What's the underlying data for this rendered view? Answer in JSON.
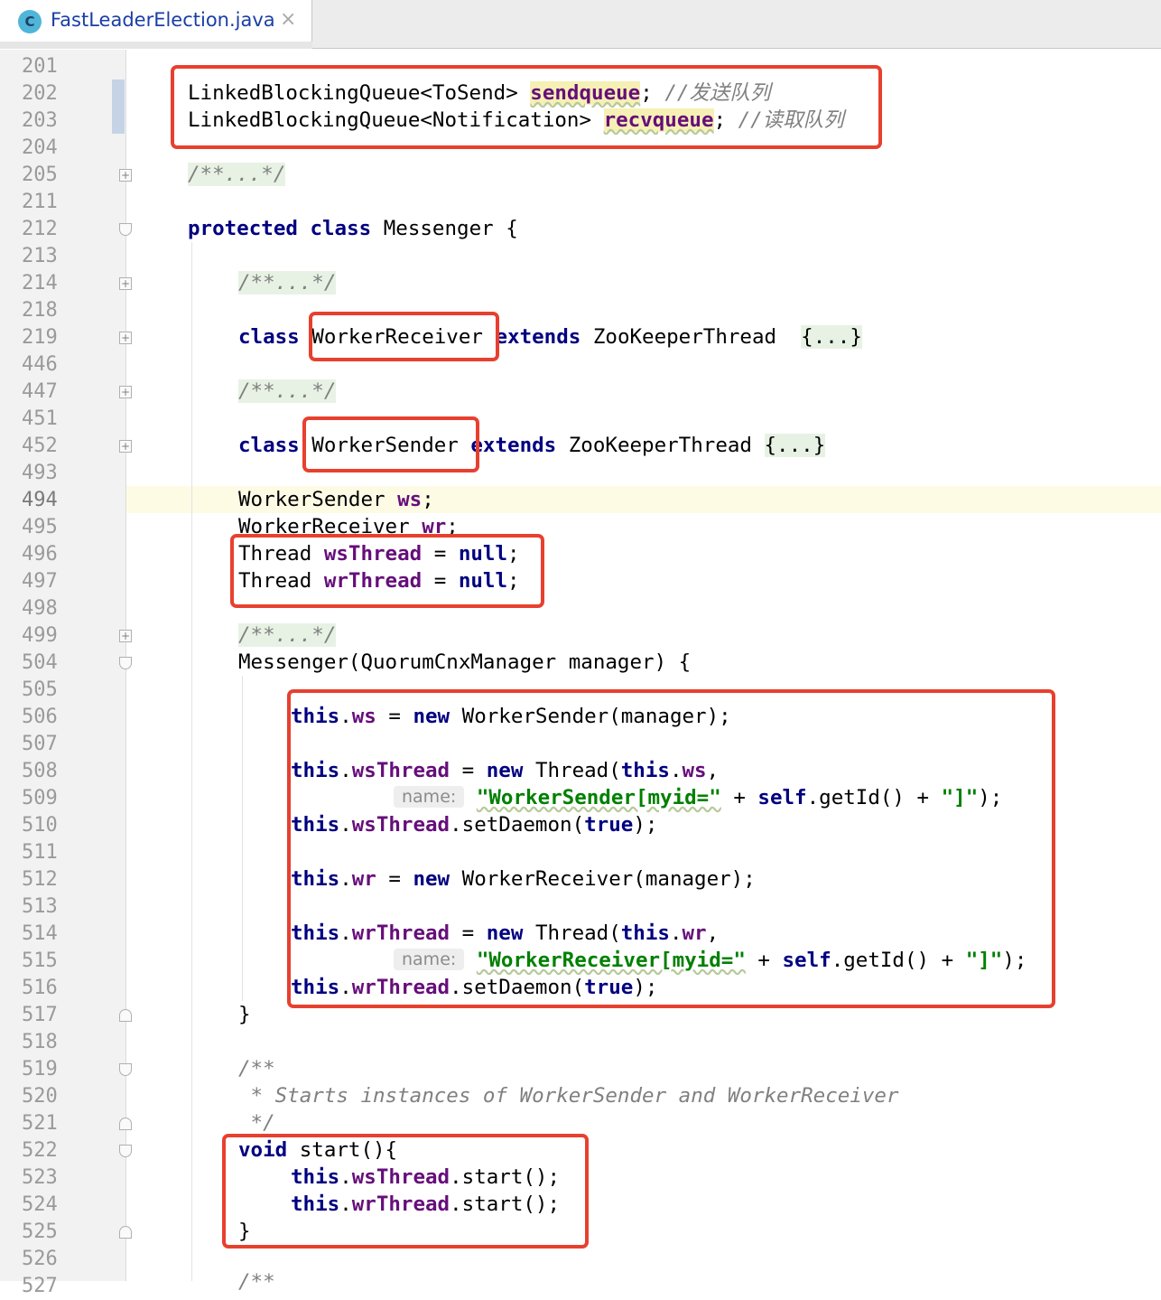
{
  "tab": {
    "icon_letter": "C",
    "title": "FastLeaderElection.java",
    "close_glyph": "×"
  },
  "line_numbers": [
    "201",
    "202",
    "203",
    "204",
    "205",
    "211",
    "212",
    "213",
    "214",
    "218",
    "219",
    "446",
    "447",
    "451",
    "452",
    "493",
    "494",
    "495",
    "496",
    "497",
    "498",
    "499",
    "504",
    "505",
    "506",
    "507",
    "508",
    "509",
    "510",
    "511",
    "512",
    "513",
    "514",
    "515",
    "516",
    "517",
    "518",
    "519",
    "520",
    "521",
    "522",
    "523",
    "524",
    "525",
    "526",
    "527"
  ],
  "folded_snippet": "/**...*/",
  "collapsed_body": "{...}",
  "code": {
    "l202": {
      "type": "LinkedBlockingQueue<ToSend>",
      "name": "sendqueue",
      "comment": "//发送队列"
    },
    "l203": {
      "type": "LinkedBlockingQueue<Notification>",
      "name": "recvqueue",
      "comment": "//读取队列"
    },
    "kw_protected": "protected",
    "kw_class": "class",
    "kw_extends": "extends",
    "kw_null": "null",
    "kw_this": "this",
    "kw_new": "new",
    "kw_true": "true",
    "kw_self": "self",
    "kw_void": "void",
    "messenger": "Messenger",
    "worker_receiver": "WorkerReceiver",
    "worker_sender": "WorkerSender",
    "zk_thread": "ZooKeeperThread",
    "thread": "Thread",
    "f_ws": "ws",
    "f_wr": "wr",
    "f_wsThread": "wsThread",
    "f_wrThread": "wrThread",
    "ctor_params": "(QuorumCnxManager manager) {",
    "manager_arg": "(manager);",
    "hint_name": "name:",
    "str_sender": "\"WorkerSender[myid=\"",
    "str_receiver": "\"WorkerReceiver[myid=\"",
    "str_close": "\"]\"",
    "get_id": ".getId() + ",
    "set_daemon": ".setDaemon(",
    "start_call": ".start();",
    "start_decl": "start(){",
    "doc_open": "/**",
    "doc_text": " * Starts instances of WorkerSender and WorkerReceiver",
    "doc_close": " */",
    "doc_open_527": "/**"
  }
}
